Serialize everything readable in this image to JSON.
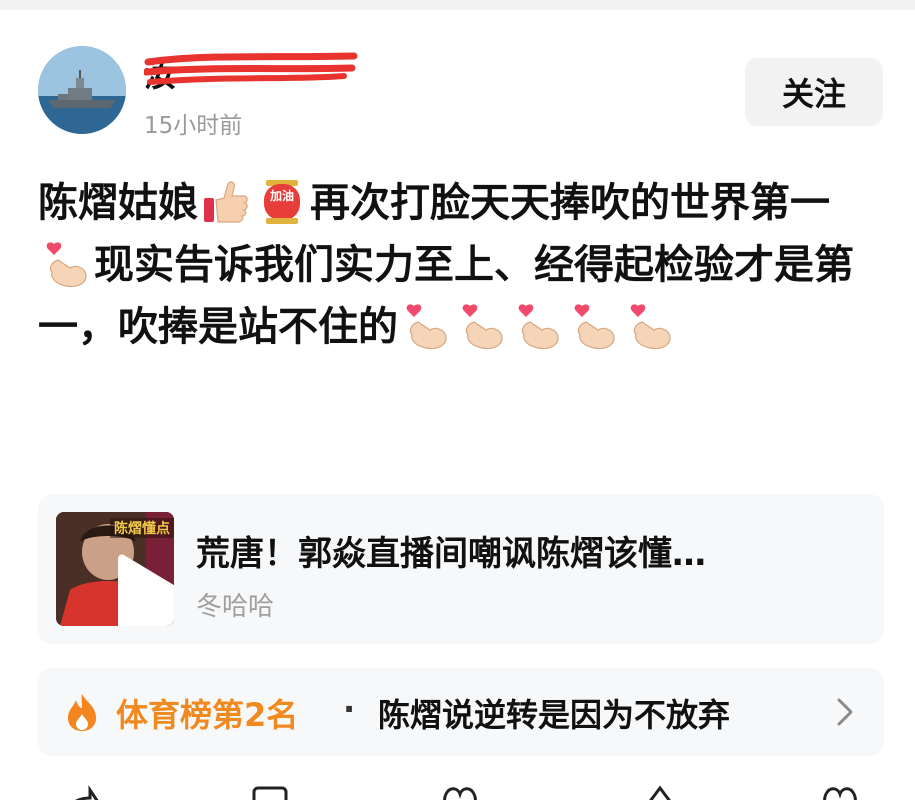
{
  "post": {
    "username": "汝",
    "timestamp": "15小时前",
    "follow_label": "关注",
    "content": {
      "p1": "陈熠姑娘",
      "p2": "再次打脸天天捧吹的世界第一",
      "p3": "现实告诉我们实力至上、经得起检验才是第一，吹捧是站不住的",
      "emoji_jiayou": "加油"
    }
  },
  "video_card": {
    "thumbnail_tag": "陈熠懂点",
    "title": "荒唐！郭焱直播间嘲讽陈熠该懂…",
    "author": "冬哈哈"
  },
  "ranking": {
    "label": "体育榜第2名",
    "separator": "·",
    "topic": "陈熠说逆转是因为不放弃"
  },
  "colors": {
    "accent_orange": "#f08a1e",
    "muted_text": "#9a9a9a",
    "card_bg": "#f7f8fa",
    "button_bg": "#f2f2f2",
    "redaction": "#e8332f"
  },
  "icons": {
    "avatar": "warship-avatar",
    "thumbs_up": "thumbs-up-emoji",
    "jiayou": "jiayou-emoji",
    "finger_heart": "finger-heart-emoji",
    "play": "play-icon",
    "flame": "flame-icon",
    "chevron": "chevron-right-icon"
  }
}
